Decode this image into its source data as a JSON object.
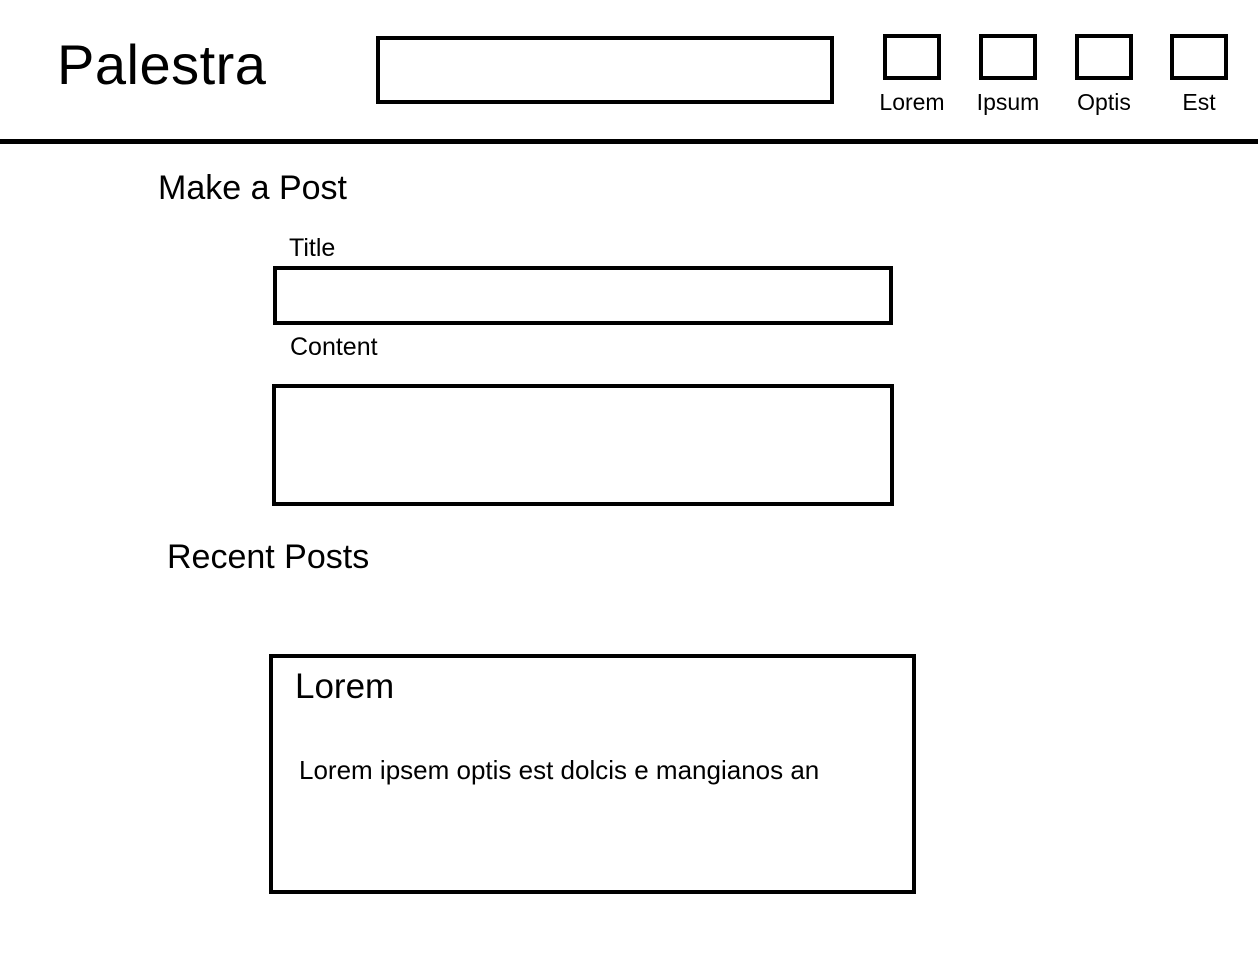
{
  "header": {
    "app_title": "Palestra",
    "search": {
      "value": "",
      "placeholder": ""
    },
    "nav": [
      {
        "label": "Lorem"
      },
      {
        "label": "Ipsum"
      },
      {
        "label": "Optis"
      },
      {
        "label": "Est"
      }
    ]
  },
  "make_post": {
    "heading": "Make a Post",
    "title_label": "Title",
    "title_value": "",
    "content_label": "Content",
    "content_value": ""
  },
  "recent_posts": {
    "heading": "Recent Posts",
    "posts": [
      {
        "title": "Lorem",
        "body": "Lorem ipsem optis est dolcis e mangianos an"
      }
    ]
  }
}
